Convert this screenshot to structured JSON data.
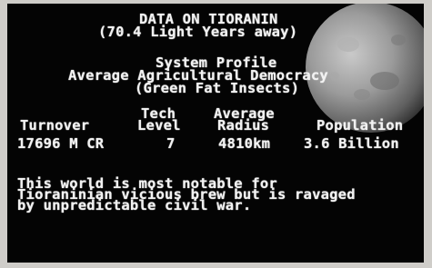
{
  "header": {
    "title": "DATA ON TIORANIN",
    "distance": "(70.4 Light Years away)"
  },
  "system": {
    "heading": "System Profile",
    "government": "Average Agricultural Democracy",
    "species": "(Green Fat Insects)"
  },
  "stats": {
    "turnover_label": "Turnover",
    "turnover_value": "17696 M CR",
    "tech_label_1": "Tech",
    "tech_label_2": "Level",
    "tech_value": "7",
    "radius_label_1": "Average",
    "radius_label_2": "Radius",
    "radius_value": "4810km",
    "population_label": "Population",
    "population_value": "3.6 Billion"
  },
  "description": {
    "line1": "This world is most notable for",
    "line2": "Tioraninian vicious brew but is ravaged",
    "line3": "by unpredictable civil war."
  },
  "colors": {
    "background": "#040404",
    "text": "#f2f2f2",
    "planet": "#9a9a9a"
  }
}
